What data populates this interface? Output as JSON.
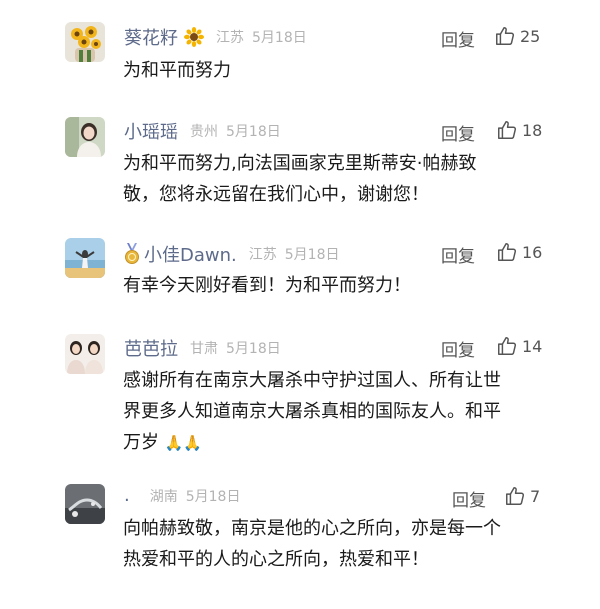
{
  "comments": [
    {
      "username": "葵花籽",
      "location": "江苏",
      "date": "5月18日",
      "reply_label": "回复",
      "likes": "25",
      "text": "为和平而努力"
    },
    {
      "username": "小瑶瑶",
      "location": "贵州",
      "date": "5月18日",
      "reply_label": "回复",
      "likes": "18",
      "text_lines": [
        "为和平而努力,向法国画家克里斯蒂安·帕赫致",
        "敬，您将永远留在我们心中，谢谢您！"
      ]
    },
    {
      "username": "小佳Dawn.",
      "location": "江苏",
      "date": "5月18日",
      "reply_label": "回复",
      "likes": "16",
      "text": "有幸今天刚好看到！为和平而努力！"
    },
    {
      "username": "芭芭拉",
      "location": "甘肃",
      "date": "5月18日",
      "reply_label": "回复",
      "likes": "14",
      "text_lines": [
        "感谢所有在南京大屠杀中守护过国人、所有让世",
        "界更多人知道南京大屠杀真相的国际友人。和平",
        "万岁"
      ],
      "emoji": "🙏🙏"
    },
    {
      "username": ".",
      "location": "湖南",
      "date": "5月18日",
      "reply_label": "回复",
      "likes": "7",
      "text_lines": [
        "向帕赫致敬，南京是他的心之所向，亦是每一个",
        "热爱和平的人的心之所向，热爱和平！"
      ]
    }
  ],
  "colors": {
    "username": "#5d6a8a",
    "meta": "#b3b3b3",
    "action": "#555555",
    "text": "#1a1a1a"
  }
}
